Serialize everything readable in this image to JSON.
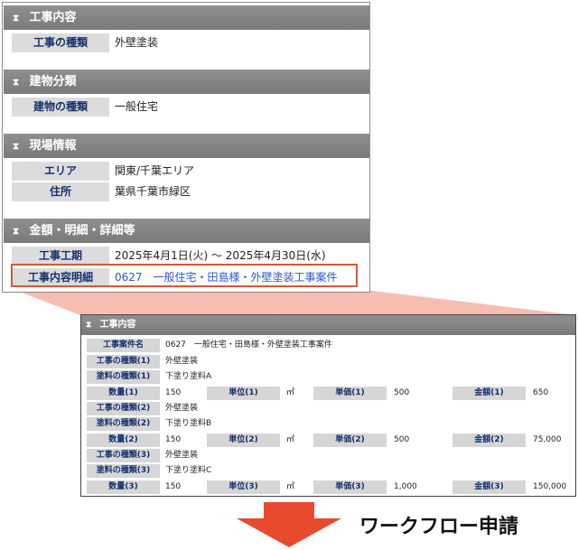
{
  "top": {
    "sections": [
      {
        "title": "工事内容",
        "rows": [
          {
            "label": "工事の種類",
            "value": "外壁塗装"
          }
        ]
      },
      {
        "title": "建物分類",
        "rows": [
          {
            "label": "建物の種類",
            "value": "一般住宅"
          }
        ]
      },
      {
        "title": "現場情報",
        "rows": [
          {
            "label": "エリア",
            "value": "関東/千葉エリア"
          },
          {
            "label": "住所",
            "value": "葉県千葉市緑区"
          }
        ]
      },
      {
        "title": "金額・明細・詳細等",
        "rows": [
          {
            "label": "工事工期",
            "value": "2025年4月1日(火) 〜 2025年4月30日(水)"
          },
          {
            "label": "工事内容明細",
            "value": "0627　一般住宅・田島様・外壁塗装工事案件"
          }
        ]
      }
    ],
    "section_glyph": "⧗"
  },
  "detail": {
    "title": "工事内容",
    "case_name": {
      "label": "工事案件名",
      "value": "0627　一般住宅・田島様・外壁塗装工事案件"
    },
    "items": [
      {
        "kind_label": "工事の種類(1)",
        "kind": "外壁塗装",
        "paint_label": "塗料の種類(1)",
        "paint": "下塗り塗料A",
        "qty_label": "数量(1)",
        "qty": "150",
        "unit_label": "単位(1)",
        "unit": "㎡",
        "price_label": "単価(1)",
        "price": "500",
        "amount_label": "金額(1)",
        "amount": "650"
      },
      {
        "kind_label": "工事の種類(2)",
        "kind": "外壁塗装",
        "paint_label": "塗料の種類(2)",
        "paint": "下塗り塗料B",
        "qty_label": "数量(2)",
        "qty": "150",
        "unit_label": "単位(2)",
        "unit": "㎡",
        "price_label": "単価(2)",
        "price": "500",
        "amount_label": "金額(2)",
        "amount": "75,000"
      },
      {
        "kind_label": "工事の種類(3)",
        "kind": "外壁塗装",
        "paint_label": "塗料の種類(3)",
        "paint": "下塗り塗料C",
        "qty_label": "数量(3)",
        "qty": "150",
        "unit_label": "単位(3)",
        "unit": "㎡",
        "price_label": "単価(3)",
        "price": "1,000",
        "amount_label": "金額(3)",
        "amount": "150,000"
      }
    ]
  },
  "footer": {
    "label": "ワークフロー申請"
  },
  "colors": {
    "header_bg": "#808080",
    "label_bg": "#dcdcdc",
    "label_text": "#15306b",
    "link": "#2a58c8",
    "highlight": "#d9573b",
    "arrow": "#e84a2e",
    "connector": "#f4b3a6"
  }
}
